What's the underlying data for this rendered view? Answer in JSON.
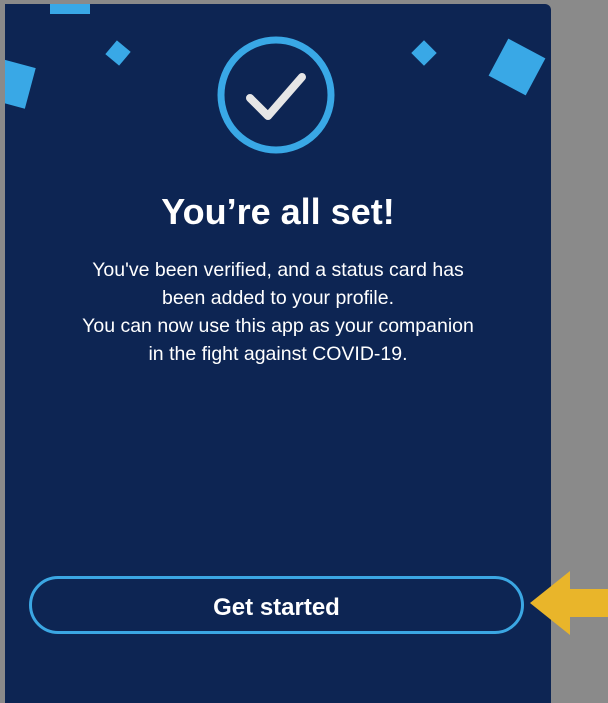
{
  "screen": {
    "title": "You’re all set!",
    "message_lines": [
      "You've been verified, and a status card has",
      "been added to your profile.",
      "You can now use this app as your companion",
      "in the fight against COVID-19."
    ],
    "primary_button_label": "Get started"
  },
  "icons": {
    "badge": "check-circle-icon",
    "pointer": "arrow-left-icon"
  },
  "colors": {
    "background": "#0d2553",
    "accent": "#39a8e6",
    "checkmark": "#e6e6e6",
    "text": "#ffffff",
    "arrow": "#e9b52a",
    "frame": "#8a8a8a"
  }
}
